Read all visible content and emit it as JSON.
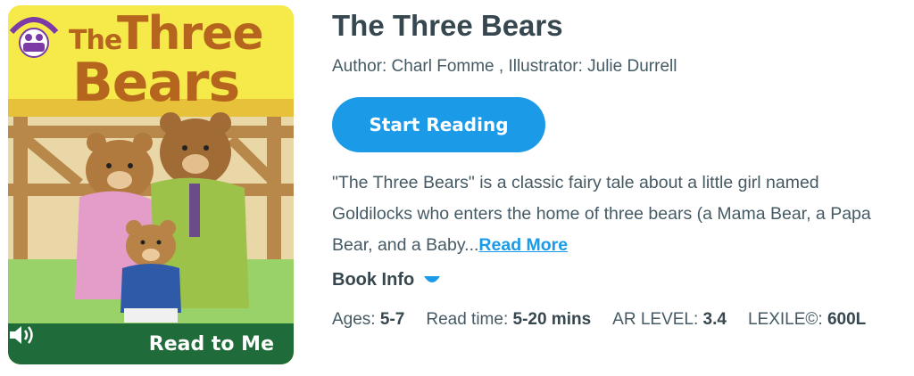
{
  "cover": {
    "title_line1": "The",
    "title_line2": "Three",
    "title_line3": "Bears",
    "badge_label": "Read to Me",
    "speaker_icon": "speaker-icon",
    "publisher_logo": "twin-sisters-logo"
  },
  "book": {
    "title": "The Three Bears",
    "byline": "Author: Charl Fomme , Illustrator: Julie Durrell",
    "start_label": "Start Reading",
    "description": "\"The Three Bears\" is a classic fairy tale about a little girl named Goldilocks who enters the home of three bears (a Mama Bear, a Papa Bear, and a Baby...",
    "read_more": "Read More",
    "book_info_label": "Book Info"
  },
  "meta": [
    {
      "label": "Ages: ",
      "value": "5-7"
    },
    {
      "label": "Read time: ",
      "value": "5-20 mins"
    },
    {
      "label": "AR LEVEL: ",
      "value": "3.4"
    },
    {
      "label": "LEXILE©: ",
      "value": "600L"
    }
  ],
  "colors": {
    "accent": "#1b9ae8",
    "title_text": "#37474f",
    "badge_green": "#1f6b3a",
    "cover_title": "#b5651d",
    "cover_background": "#f6e94a"
  }
}
